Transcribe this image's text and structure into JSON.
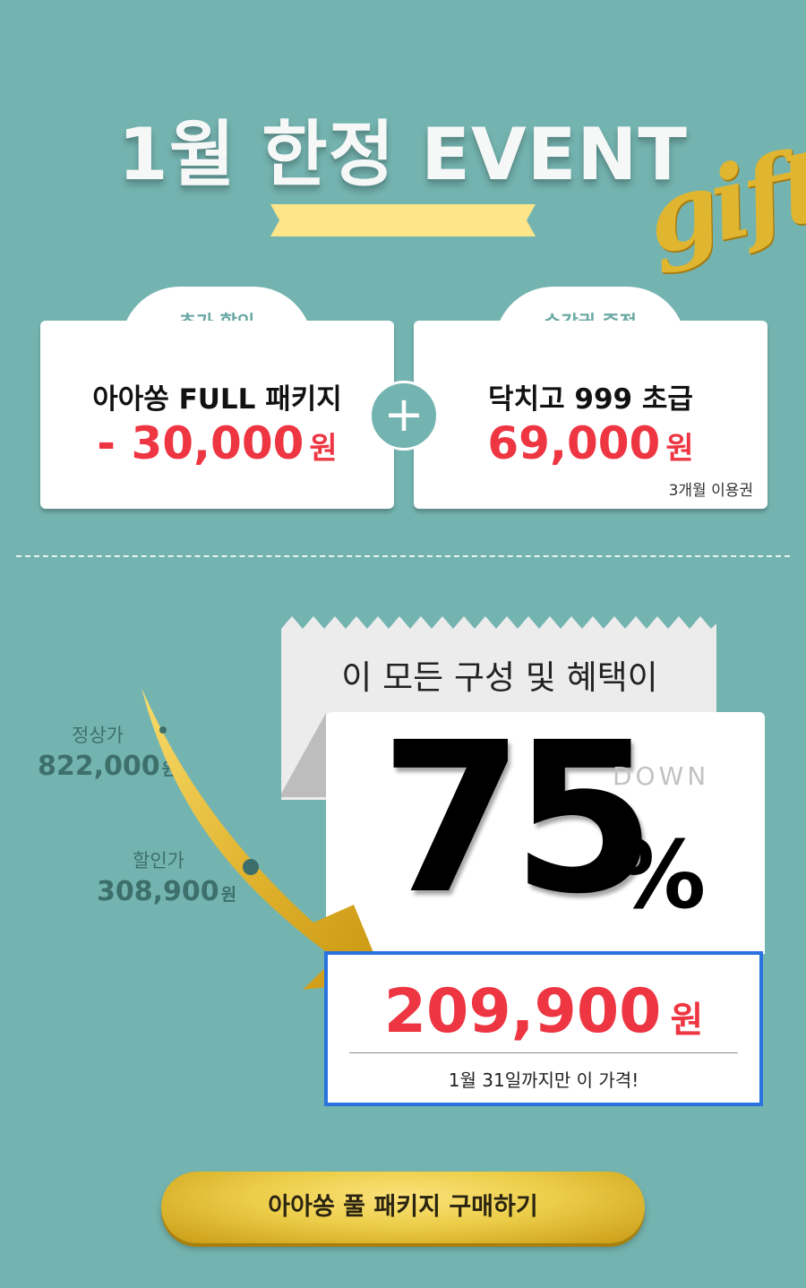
{
  "event": {
    "title": "1월 한정 EVENT",
    "gift_word": "gift"
  },
  "offers": [
    {
      "tab_label": "추가 할인",
      "name": "아아쏭 FULL 패키지",
      "price": "- 30,000",
      "unit": "원"
    },
    {
      "tab_label": "수강권 증정",
      "name": "닥치고 999 초급",
      "price": "69,000",
      "unit": "원",
      "note": "3개월 이용권"
    }
  ],
  "plus_symbol": "+",
  "regular": {
    "label": "정상가",
    "price": "822,000",
    "unit": "원"
  },
  "discounted": {
    "label": "할인가",
    "price": "308,900",
    "unit": "원"
  },
  "summary": {
    "headline": "이 모든 구성 및 혜택이",
    "percent": "75",
    "percent_sign": "%",
    "down_label": "DOWN",
    "final_price": "209,900",
    "unit": "원",
    "deadline": "1월 31일까지만 이 가격!"
  },
  "cta": {
    "label": "아아쏭 풀 패키지 구매하기"
  },
  "colors": {
    "background": "#74b4b0",
    "accent_red": "#ee3542",
    "gold": "#e0b530",
    "box_border": "#2a72e0",
    "ribbon": "#fde58a"
  }
}
